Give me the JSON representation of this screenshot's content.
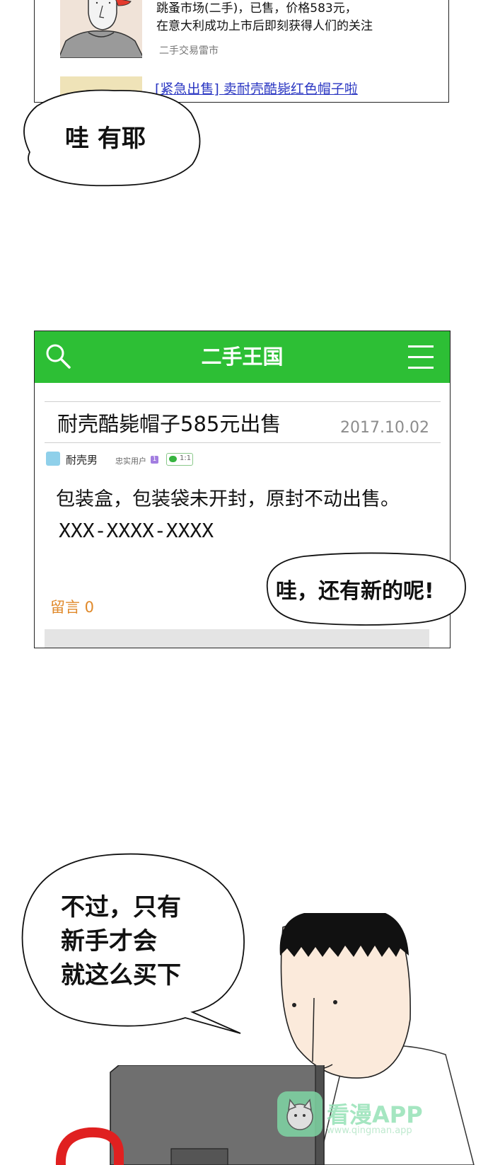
{
  "top_card": {
    "headline_line1": "跳蚤市场(二手)，已售，价格583元，",
    "headline_line2": "在意大利成功上市后即刻获得人们的关注",
    "source": "二手交易雷市",
    "link": "[紧急出售] 卖耐壳酷毙红色帽子啦"
  },
  "bubble_1": {
    "text": "哇 有耶"
  },
  "marketplace": {
    "app_title": "二手王国",
    "post_title": "耐壳酷毙帽子585元出售",
    "post_date": "2017.10.02",
    "user_name": "耐壳男",
    "user_tag": "忠实用户",
    "user_level": "1",
    "chat_badge": "1:1",
    "body_line1": "包装盒，包装袋未开封，原封不动出售。",
    "body_line2": "XXX-XXXX-XXXX",
    "comment_label": "留言 0"
  },
  "bubble_2": {
    "text": "哇，还有新的呢!"
  },
  "bubble_3": {
    "line1": "不过，只有",
    "line2": "新手才会",
    "line3": "就这么买下"
  },
  "watermark": {
    "text": "看漫APP",
    "url": "www.qingman.app"
  },
  "colors": {
    "market_green": "#2dbf35",
    "link_blue": "#2a36c2",
    "comment_orange": "#e0892a",
    "skin": "#fbeadb",
    "monitor_gray": "#6f6f6f",
    "accent_red": "#e02020"
  }
}
